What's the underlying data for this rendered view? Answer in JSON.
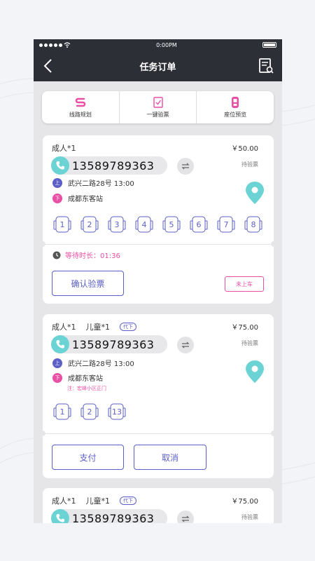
{
  "status_bar": {
    "time": "0:00PM"
  },
  "header": {
    "title": "任务订单",
    "back_icon": "back-arrow-icon",
    "right_icon": "order-list-icon"
  },
  "quick_actions": [
    {
      "label": "线路规划",
      "icon": "route-icon"
    },
    {
      "label": "一键验票",
      "icon": "ticket-check-icon"
    },
    {
      "label": "座位预览",
      "icon": "seat-preview-icon"
    }
  ],
  "colors": {
    "accent": "#5b5fc7",
    "pink": "#ea4fa6",
    "teal": "#6cd3d4",
    "header": "#2d2f36"
  },
  "orders": [
    {
      "passengers": "成人*1",
      "child": "",
      "tag": "",
      "price": "￥50.00",
      "status": "待验票",
      "phone": "13589789363",
      "pickup_marker": "上",
      "pickup": "武兴二路28号  13:00",
      "dropoff_marker": "下",
      "dropoff": "成都东客站",
      "note": "",
      "seats": [
        "1",
        "2",
        "3",
        "4",
        "5",
        "6",
        "7",
        "8"
      ],
      "wait_label": "等待时长：01:36",
      "primary_button": "确认验票",
      "secondary_button": "未上车"
    },
    {
      "passengers": "成人*1",
      "child": "儿童*1",
      "tag": "代下",
      "price": "￥75.00",
      "status": "待验票",
      "phone": "13589789363",
      "pickup_marker": "上",
      "pickup": "武兴二路28号  13:00",
      "dropoff_marker": "下",
      "dropoff": "成都东客站",
      "note": "注：宏峰小区正门",
      "seats": [
        "1",
        "2",
        "13"
      ],
      "primary_button": "支付",
      "secondary_button": "取消"
    },
    {
      "passengers": "成人*1",
      "child": "儿童*1",
      "tag": "代下",
      "price": "￥75.00",
      "status": "待验票",
      "phone": "13589789363"
    }
  ]
}
